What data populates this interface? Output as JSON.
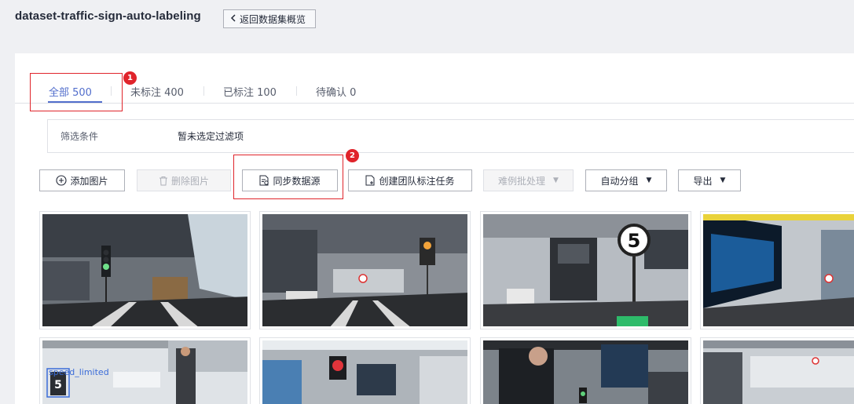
{
  "header": {
    "title": "dataset-traffic-sign-auto-labeling",
    "back_label": "返回数据集概览"
  },
  "tabs": [
    {
      "label": "全部 500"
    },
    {
      "label": "未标注 400"
    },
    {
      "label": "已标注 100"
    },
    {
      "label": "待确认 0"
    }
  ],
  "filter": {
    "label": "筛选条件",
    "value": "暂未选定过滤项"
  },
  "toolbar": {
    "add_image": "添加图片",
    "delete_image": "删除图片",
    "sync_source": "同步数据源",
    "create_team_task": "创建团队标注任务",
    "hard_batch": "难例批处理",
    "auto_group": "自动分组",
    "export": "导出"
  },
  "annotations": {
    "step1": "1",
    "step2": "2"
  },
  "images": {
    "label_text": "speed_limited",
    "sign_number": "5"
  },
  "colors": {
    "accent": "#526ecc",
    "highlight": "#e0242b"
  }
}
